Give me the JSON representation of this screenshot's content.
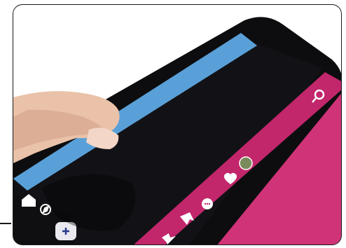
{
  "photo": {
    "colors": {
      "phone_body": "#0d0d0f",
      "screen": "#111114",
      "top_bar": "#5aa0d8",
      "bottom_bar": "#c2266b",
      "skin": "#e9c2a9",
      "skin_shadow": "#cf9f85"
    },
    "icons": [
      "search-icon",
      "avatar-icon",
      "heart-icon",
      "chat-icon",
      "bookmark-icon",
      "share-icon",
      "home-icon",
      "compass-icon",
      "add-icon"
    ]
  }
}
